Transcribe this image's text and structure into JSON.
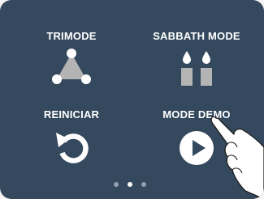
{
  "menu": {
    "tiles": [
      {
        "label": "TRIMODE",
        "icon": "trimode-triangle-icon"
      },
      {
        "label": "SABBATH MODE",
        "icon": "candles-icon"
      },
      {
        "label": "REINICIAR",
        "icon": "restart-arrow-icon"
      },
      {
        "label": "MODE DEMO",
        "icon": "play-icon"
      }
    ]
  },
  "pager": {
    "pages": 3,
    "current": 2
  },
  "colors": {
    "background": "#35495e",
    "foreground": "#ffffff",
    "icon_gray": "#b4b4b4",
    "dot_inactive": "#93a1b0"
  },
  "overlay": {
    "icon": "pointing-hand-icon"
  }
}
